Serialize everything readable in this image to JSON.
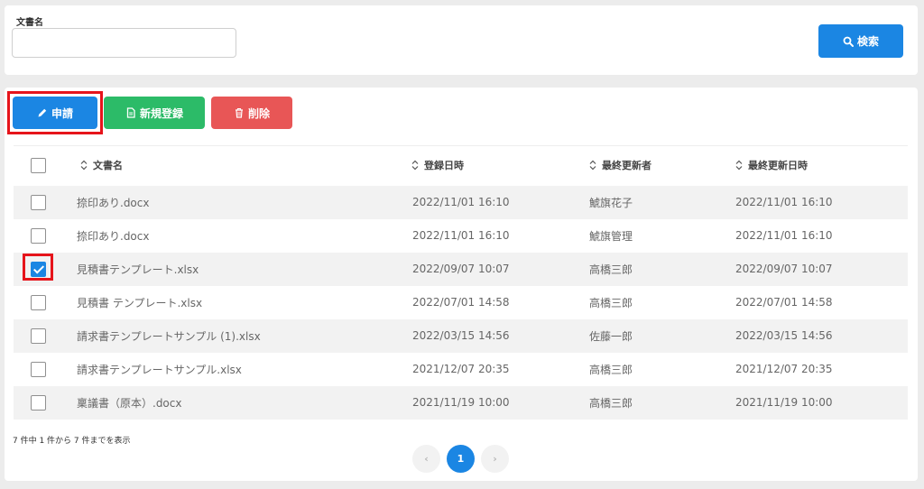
{
  "search": {
    "label": "文書名",
    "value": "",
    "placeholder": "",
    "button_label": "検索"
  },
  "toolbar": {
    "apply_label": "申請",
    "new_label": "新規登録",
    "delete_label": "削除"
  },
  "table": {
    "headers": {
      "name": "文書名",
      "registered": "登録日時",
      "last_user": "最終更新者",
      "last_updated": "最終更新日時"
    },
    "rows": [
      {
        "checked": false,
        "name": "捺印あり.docx",
        "registered": "2022/11/01 16:10",
        "last_user": "鯱旗花子",
        "last_updated": "2022/11/01 16:10"
      },
      {
        "checked": false,
        "name": "捺印あり.docx",
        "registered": "2022/11/01 16:10",
        "last_user": "鯱旗管理",
        "last_updated": "2022/11/01 16:10"
      },
      {
        "checked": true,
        "name": "見積書テンプレート.xlsx",
        "registered": "2022/09/07 10:07",
        "last_user": "高橋三郎",
        "last_updated": "2022/09/07 10:07"
      },
      {
        "checked": false,
        "name": "見積書 テンプレート.xlsx",
        "registered": "2022/07/01 14:58",
        "last_user": "高橋三郎",
        "last_updated": "2022/07/01 14:58"
      },
      {
        "checked": false,
        "name": "請求書テンプレートサンプル (1).xlsx",
        "registered": "2022/03/15 14:56",
        "last_user": "佐藤一郎",
        "last_updated": "2022/03/15 14:56"
      },
      {
        "checked": false,
        "name": "請求書テンプレートサンプル.xlsx",
        "registered": "2021/12/07 20:35",
        "last_user": "高橋三郎",
        "last_updated": "2021/12/07 20:35"
      },
      {
        "checked": false,
        "name": "稟議書（原本）.docx",
        "registered": "2021/11/19 10:00",
        "last_user": "高橋三郎",
        "last_updated": "2021/11/19 10:00"
      }
    ]
  },
  "footer": {
    "summary": "7 件中 1 件から 7 件までを表示"
  },
  "pagination": {
    "prev": "‹",
    "current": "1",
    "next": "›"
  },
  "colors": {
    "primary": "#1b86e3",
    "success": "#2cbb68",
    "danger": "#e85656",
    "highlight": "#e6141b"
  },
  "icons": {
    "search_button": "search-icon",
    "apply_button": "pencil-icon",
    "new_button": "document-icon",
    "delete_button": "trash-icon",
    "sort": "sort-icon"
  }
}
